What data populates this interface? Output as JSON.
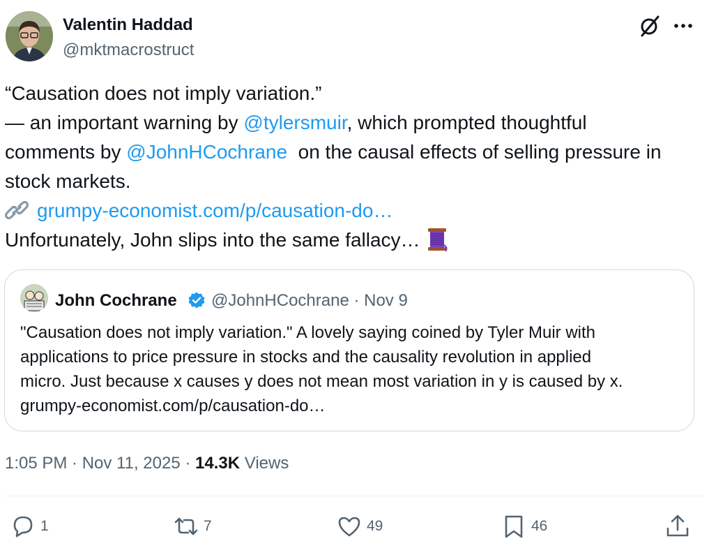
{
  "author": {
    "name": "Valentin Haddad",
    "handle": "@mktmacrostruct"
  },
  "tweet": {
    "line1": "“Causation does not imply variation.”",
    "line2_pre": "— an important warning by ",
    "mention1": "@tylersmuir",
    "line2_post": ", which prompted thoughtful",
    "line3_pre": "comments by ",
    "mention2": "@JohnHCochrane",
    "line3_post": "  on the causal effects of selling pressure in",
    "line4": "stock markets.",
    "link": "grumpy-economist.com/p/causation-do…",
    "line6": "Unfortunately, John slips into the same fallacy…"
  },
  "quote": {
    "name": "John Cochrane",
    "handle_date": "@JohnHCochrane · Nov 9",
    "lines": [
      "\"Causation does not imply variation.\" A lovely saying coined by Tyler Muir with",
      "applications to price pressure in stocks and the causality revolution in applied",
      "micro. Just because x causes y does not mean most variation in y is caused by x.",
      "grumpy-economist.com/p/causation-do…"
    ]
  },
  "meta": {
    "time_date": "1:05 PM · Nov 11, 2025 · ",
    "views_count": "14.3K",
    "views_label": " Views"
  },
  "actions": {
    "replies": "1",
    "reposts": "7",
    "likes": "49",
    "bookmarks": "46"
  },
  "colors": {
    "link": "#1d9bf0",
    "secondary_text": "#536471",
    "border": "#cfd9de"
  },
  "icons": [
    "grok-icon",
    "more-icon",
    "link-icon",
    "thread-emoji-icon",
    "verified-badge-icon",
    "reply-icon",
    "repost-icon",
    "like-icon",
    "bookmark-icon",
    "share-icon"
  ]
}
